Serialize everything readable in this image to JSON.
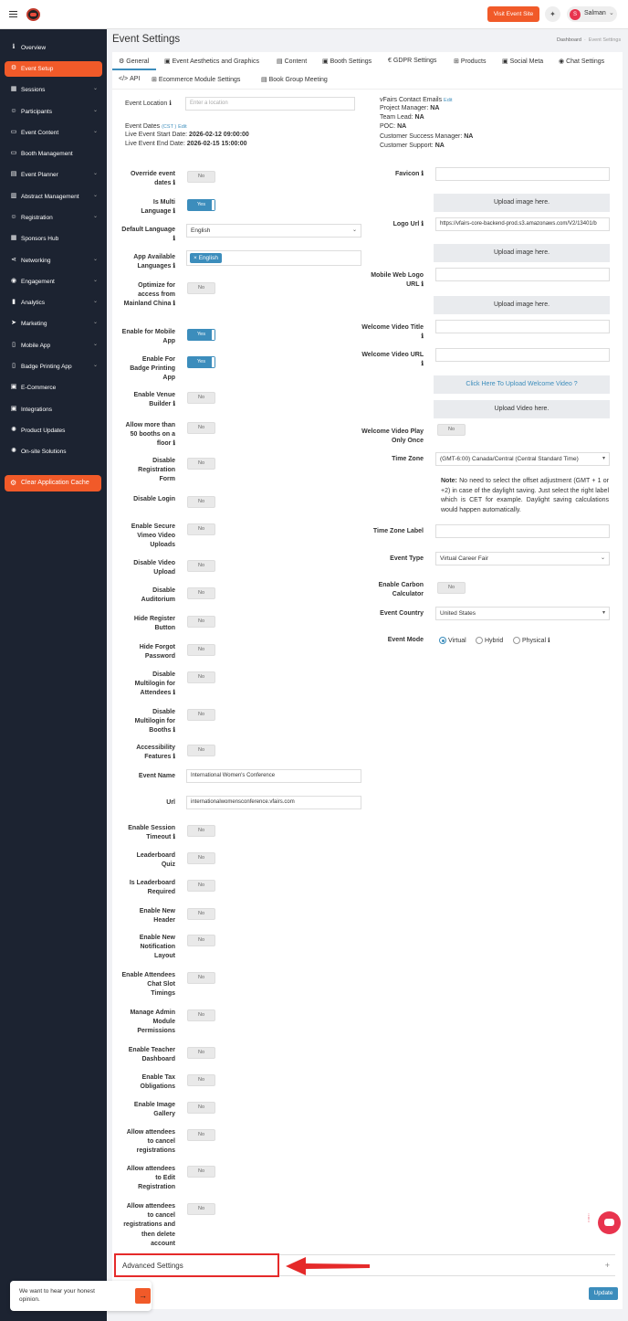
{
  "topbar": {
    "visit_label": "Visit Event Site",
    "user_initial": "S",
    "user_name": "Salman"
  },
  "sidebar": {
    "items": [
      {
        "label": "Overview",
        "icon": "info-icon",
        "active": false,
        "expand": false
      },
      {
        "label": "Event Setup",
        "icon": "gear-icon",
        "active": true,
        "expand": false
      },
      {
        "label": "Sessions",
        "icon": "grid-icon",
        "active": false,
        "expand": true
      },
      {
        "label": "Participants",
        "icon": "users-icon",
        "active": false,
        "expand": true
      },
      {
        "label": "Event Content",
        "icon": "folder-icon",
        "active": false,
        "expand": true
      },
      {
        "label": "Booth Management",
        "icon": "booth-icon",
        "active": false,
        "expand": false
      },
      {
        "label": "Event Planner",
        "icon": "calendar-icon",
        "active": false,
        "expand": true
      },
      {
        "label": "Abstract Management",
        "icon": "document-icon",
        "active": false,
        "expand": true
      },
      {
        "label": "Registration",
        "icon": "user-plus-icon",
        "active": false,
        "expand": true
      },
      {
        "label": "Sponsors Hub",
        "icon": "tiles-icon",
        "active": false,
        "expand": false
      },
      {
        "label": "Networking",
        "icon": "share-icon",
        "active": false,
        "expand": true
      },
      {
        "label": "Engagement",
        "icon": "chat-icon",
        "active": false,
        "expand": true
      },
      {
        "label": "Analytics",
        "icon": "bar-chart-icon",
        "active": false,
        "expand": true
      },
      {
        "label": "Marketing",
        "icon": "send-icon",
        "active": false,
        "expand": true
      },
      {
        "label": "Mobile App",
        "icon": "mobile-icon",
        "active": false,
        "expand": true
      },
      {
        "label": "Badge Printing App",
        "icon": "badge-icon",
        "active": false,
        "expand": true
      },
      {
        "label": "E-Commerce",
        "icon": "cart-icon",
        "active": false,
        "expand": false
      },
      {
        "label": "Integrations",
        "icon": "plug-icon",
        "active": false,
        "expand": false
      },
      {
        "label": "Product Updates",
        "icon": "bulb-icon",
        "active": false,
        "expand": false
      },
      {
        "label": "On-site Solutions",
        "icon": "bulb-icon",
        "active": false,
        "expand": false
      }
    ],
    "cache_label": "Clear Application Cache"
  },
  "page": {
    "title": "Event Settings",
    "breadcrumb_home": "Dashboard",
    "breadcrumb_current": "Event Settings"
  },
  "tabs": [
    {
      "label": "General",
      "icon": "gear-icon"
    },
    {
      "label": "Event Aesthetics and Graphics",
      "icon": "image-icon"
    },
    {
      "label": "Content",
      "icon": "file-icon"
    },
    {
      "label": "Booth Settings",
      "icon": "image-icon"
    },
    {
      "label": "GDPR Settings",
      "icon": "euro-icon"
    },
    {
      "label": "Products",
      "icon": "cart-icon"
    },
    {
      "label": "Social Meta",
      "icon": "social-icon"
    },
    {
      "label": "Chat Settings",
      "icon": "chat-icon"
    },
    {
      "label": "API",
      "icon": "code-icon"
    },
    {
      "label": "Ecommerce Module Settings",
      "icon": "cart-icon"
    },
    {
      "label": "Book Group Meeting",
      "icon": "file-icon"
    }
  ],
  "event_info": {
    "location_label": "Event Location",
    "location_placeholder": "Enter a location",
    "dates_label": "Event Dates",
    "tz_abbr": "(CST )",
    "edit": "Edit",
    "start_label": "Live Event Start Date:",
    "start_value": "2026-02-12 09:00:00",
    "end_label": "Live Event End Date:",
    "end_value": "2026-02-15 15:00:00"
  },
  "contacts": {
    "title": "vFairs Contact Emails",
    "edit": "Edit",
    "rows": [
      {
        "label": "Project Manager:",
        "value": "NA"
      },
      {
        "label": "Team Lead:",
        "value": "NA"
      },
      {
        "label": "POC:",
        "value": "NA"
      },
      {
        "label": "Customer Success Manager:",
        "value": "NA"
      },
      {
        "label": "Customer Support:",
        "value": "NA"
      }
    ]
  },
  "left_settings": [
    {
      "key": "override_dates",
      "label": "Override event dates",
      "value": "No"
    },
    {
      "key": "multi_language",
      "label": "Is Multi Language",
      "value": "Yes"
    },
    {
      "key": "default_language",
      "label": "Default Language",
      "value": "English"
    },
    {
      "key": "app_languages",
      "label": "App Available Languages",
      "value": "English"
    },
    {
      "key": "optimize_china",
      "label": "Optimize for access from Mainland China",
      "value": "No"
    },
    {
      "key": "mobile_app",
      "label": "Enable for Mobile App",
      "value": "Yes"
    },
    {
      "key": "badge_app",
      "label": "Enable For Badge Printing App",
      "value": "Yes"
    },
    {
      "key": "venue_builder",
      "label": "Enable Venue Builder",
      "value": "No"
    },
    {
      "key": "booths_floor",
      "label": "Allow more than 50 booths on a floor",
      "value": "No"
    },
    {
      "key": "disable_reg_form",
      "label": "Disable Registration Form",
      "value": "No"
    },
    {
      "key": "disable_login",
      "label": "Disable Login",
      "value": "No"
    },
    {
      "key": "vimeo_uploads",
      "label": "Enable Secure Vimeo Video Uploads",
      "value": "No"
    },
    {
      "key": "disable_video_upload",
      "label": "Disable Video Upload",
      "value": "No"
    },
    {
      "key": "disable_auditorium",
      "label": "Disable Auditorium",
      "value": "No"
    },
    {
      "key": "hide_register",
      "label": "Hide Register Button",
      "value": "No"
    },
    {
      "key": "hide_forgot",
      "label": "Hide Forgot Password",
      "value": "No"
    },
    {
      "key": "multilogin_attendees",
      "label": "Disable Multilogin for Attendees",
      "value": "No"
    },
    {
      "key": "multilogin_booths",
      "label": "Disable Multilogin for Booths",
      "value": "No"
    },
    {
      "key": "accessibility",
      "label": "Accessibility Features",
      "value": "No"
    },
    {
      "key": "event_name",
      "label": "Event Name",
      "value": "International Women's Conference"
    },
    {
      "key": "url",
      "label": "Url",
      "value": "internationalwomensconference.vfairs.com"
    },
    {
      "key": "session_timeout",
      "label": "Enable Session Timeout",
      "value": "No"
    },
    {
      "key": "leaderboard_quiz",
      "label": "Leaderboard Quiz",
      "value": "No"
    },
    {
      "key": "leaderboard_required",
      "label": "Is Leaderboard Required",
      "value": "No"
    },
    {
      "key": "new_header",
      "label": "Enable New Header",
      "value": "No"
    },
    {
      "key": "notification_layout",
      "label": "Enable New Notification Layout",
      "value": "No"
    },
    {
      "key": "chat_slot_timings",
      "label": "Enable Attendees Chat Slot Timings",
      "value": "No"
    },
    {
      "key": "admin_permissions",
      "label": "Manage Admin Module Permissions",
      "value": "No"
    },
    {
      "key": "teacher_dashboard",
      "label": "Enable Teacher Dashboard",
      "value": "No"
    },
    {
      "key": "tax_obligations",
      "label": "Enable Tax Obligations",
      "value": "No"
    },
    {
      "key": "image_gallery",
      "label": "Enable Image Gallery",
      "value": "No"
    },
    {
      "key": "cancel_registrations",
      "label": "Allow attendees to cancel registrations",
      "value": "No"
    },
    {
      "key": "edit_registration",
      "label": "Allow attendees to Edit Registration",
      "value": "No"
    },
    {
      "key": "cancel_delete",
      "label": "Allow attendees to cancel registrations and then delete account",
      "value": "No"
    }
  ],
  "right_settings": {
    "favicon_label": "Favicon",
    "upload_image": "Upload image here.",
    "logo_label": "Logo Url",
    "logo_value": "https://vfairs-core-backend-prod.s3.amazonaws.com/V2/13401/b",
    "mobile_logo_label": "Mobile Web Logo URL",
    "welcome_title_label": "Welcome Video Title",
    "welcome_url_label": "Welcome Video URL",
    "upload_welcome_label": "Click Here To Upload Welcome Video",
    "upload_video": "Upload Video here.",
    "play_once_label": "Welcome Video Play Only Once",
    "play_once_value": "No",
    "timezone_label": "Time Zone",
    "timezone_value": "(GMT-6:00) Canada/Central (Central Standard Time)",
    "note_label": "Note:",
    "note_text": "No need to select the offset adjustment (GMT + 1 or +2) in case of the daylight saving. Just select the right label which is CET for example. Daylight saving calculations would happen automatically.",
    "tz_label_label": "Time Zone Label",
    "event_type_label": "Event Type",
    "event_type_value": "Virtual Career Fair",
    "carbon_label": "Enable Carbon Calculator",
    "carbon_value": "No",
    "country_label": "Event Country",
    "country_value": "United States",
    "mode_label": "Event Mode",
    "modes": [
      "Virtual",
      "Hybrid",
      "Physical"
    ],
    "mode_selected": "Virtual"
  },
  "advanced": {
    "label": "Advanced Settings"
  },
  "update_label": "Update",
  "feedback": {
    "text": "We want to hear your honest opinion."
  },
  "colors": {
    "accent": "#f15a29",
    "primary": "#3c8dbc",
    "sidebar": "#1c2331",
    "highlight": "#e52a2a"
  }
}
